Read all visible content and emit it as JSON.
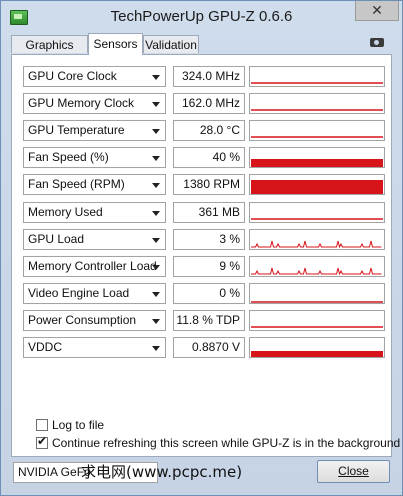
{
  "window": {
    "title": "TechPowerUp GPU-Z 0.6.6",
    "close_glyph": "✕"
  },
  "tabs": [
    {
      "label": "Graphics Card"
    },
    {
      "label": "Sensors"
    },
    {
      "label": "Validation"
    }
  ],
  "sensors": [
    {
      "name": "GPU Core Clock",
      "value": "324.0 MHz",
      "level": 0.12,
      "style": "line"
    },
    {
      "name": "GPU Memory Clock",
      "value": "162.0 MHz",
      "level": 0.08,
      "style": "line"
    },
    {
      "name": "GPU Temperature",
      "value": "28.0 °C",
      "level": 0.1,
      "style": "line"
    },
    {
      "name": "Fan Speed (%)",
      "value": "40 %",
      "level": 0.4,
      "style": "bar"
    },
    {
      "name": "Fan Speed (RPM)",
      "value": "1380 RPM",
      "level": 0.72,
      "style": "bar"
    },
    {
      "name": "Memory Used",
      "value": "361 MB",
      "level": 0.1,
      "style": "line"
    },
    {
      "name": "GPU Load",
      "value": "3 %",
      "level": 0.03,
      "style": "spiky"
    },
    {
      "name": "Memory Controller Load",
      "value": "9 %",
      "level": 0.05,
      "style": "spiky"
    },
    {
      "name": "Video Engine Load",
      "value": "0 %",
      "level": 0.0,
      "style": "line"
    },
    {
      "name": "Power Consumption",
      "value": "11.8 % TDP",
      "level": 0.12,
      "style": "line"
    },
    {
      "name": "VDDC",
      "value": "0.8870 V",
      "level": 0.3,
      "style": "bar"
    }
  ],
  "options": {
    "log_to_file": {
      "label": "Log to file",
      "checked": false
    },
    "continue_refresh": {
      "label": "Continue refreshing this screen while GPU-Z is in the background",
      "checked": true
    }
  },
  "footer": {
    "gpu_name": "NVIDIA GeFo",
    "close_label": "Close",
    "watermark": "求电网(www.pcpc.me)"
  },
  "colors": {
    "graph": "#d7141a"
  },
  "icons": {
    "app": "gpu-z-icon",
    "screenshot": "camera-icon",
    "dropdown": "chevron-down-icon"
  }
}
